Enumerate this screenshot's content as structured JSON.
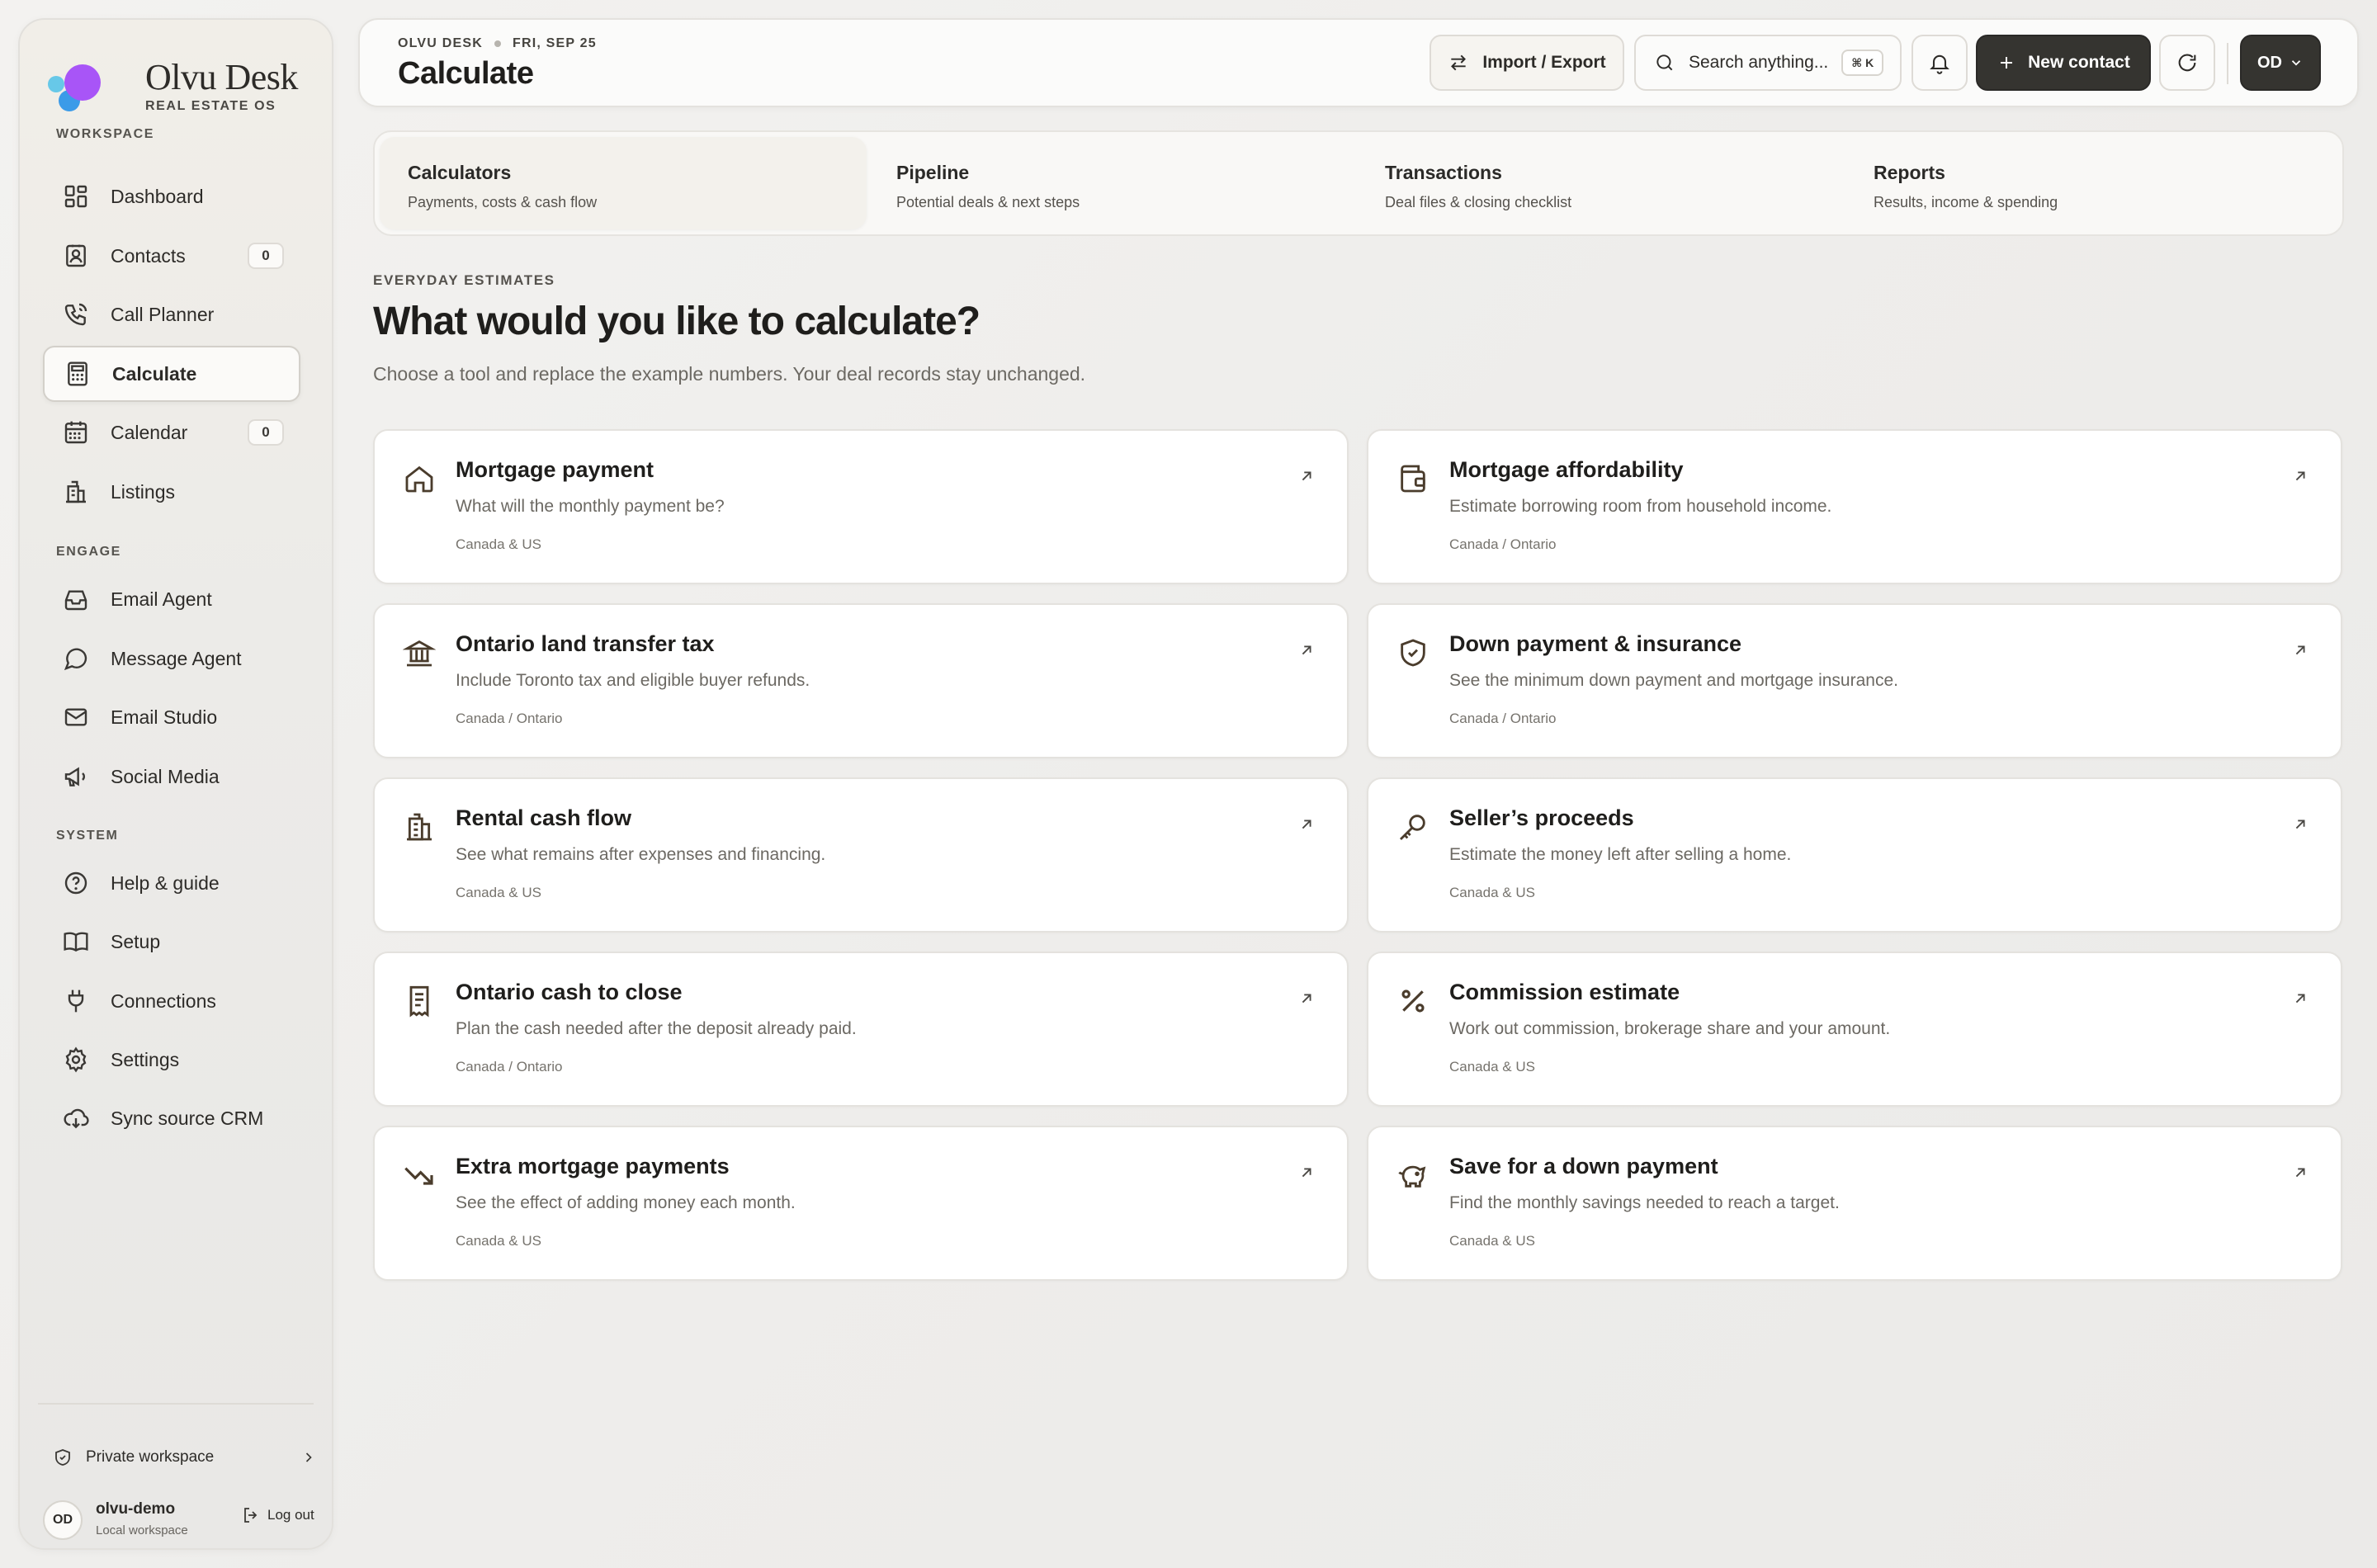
{
  "brand": {
    "name": "Olvu Desk",
    "subtitle": "REAL ESTATE OS",
    "colors": {
      "dot_purple": "#a855f7",
      "dot_blue": "#3b9be8",
      "dot_cyan": "#67c8e8"
    }
  },
  "sidebar": {
    "sections": [
      {
        "label": "WORKSPACE"
      },
      {
        "label": "ENGAGE"
      },
      {
        "label": "SYSTEM"
      }
    ],
    "items": [
      {
        "label": "Dashboard",
        "icon": "dashboard-icon"
      },
      {
        "label": "Contacts",
        "icon": "contacts-icon",
        "count": "0"
      },
      {
        "label": "Call Planner",
        "icon": "phone-icon"
      },
      {
        "label": "Calculate",
        "icon": "calculator-icon",
        "active": true
      },
      {
        "label": "Calendar",
        "icon": "calendar-icon",
        "count": "0"
      },
      {
        "label": "Listings",
        "icon": "building-icon"
      },
      {
        "label": "Email Agent",
        "icon": "inbox-icon"
      },
      {
        "label": "Message Agent",
        "icon": "message-icon"
      },
      {
        "label": "Email Studio",
        "icon": "mail-icon"
      },
      {
        "label": "Social Media",
        "icon": "megaphone-icon"
      },
      {
        "label": "Help & guide",
        "icon": "help-icon"
      },
      {
        "label": "Setup",
        "icon": "book-icon"
      },
      {
        "label": "Connections",
        "icon": "plug-icon"
      },
      {
        "label": "Settings",
        "icon": "gear-icon"
      },
      {
        "label": "Sync source CRM",
        "icon": "cloud-sync-icon"
      }
    ],
    "workspace_label": "Private workspace",
    "user": {
      "initials": "OD",
      "name": "olvu-demo",
      "sub": "Local workspace",
      "logout": "Log out"
    }
  },
  "topbar": {
    "crumb_app": "OLVU DESK",
    "crumb_date": "FRI, SEP 25",
    "title": "Calculate",
    "import_export": "Import / Export",
    "search_placeholder": "Search anything...",
    "search_shortcut": "⌘ K",
    "new_contact": "New contact",
    "account_initials": "OD"
  },
  "tabs": [
    {
      "title": "Calculators",
      "sub": "Payments, costs & cash flow",
      "active": true
    },
    {
      "title": "Pipeline",
      "sub": "Potential deals & next steps"
    },
    {
      "title": "Transactions",
      "sub": "Deal files & closing checklist"
    },
    {
      "title": "Reports",
      "sub": "Results, income & spending"
    }
  ],
  "hero": {
    "eyebrow": "EVERYDAY ESTIMATES",
    "headline": "What would you like to calculate?",
    "subline": "Choose a tool and replace the example numbers. Your deal records stay unchanged."
  },
  "cards": [
    {
      "title": "Mortgage payment",
      "desc": "What will the monthly payment be?",
      "region": "Canada & US",
      "icon": "home-icon"
    },
    {
      "title": "Mortgage affordability",
      "desc": "Estimate borrowing room from household income.",
      "region": "Canada / Ontario",
      "icon": "wallet-icon"
    },
    {
      "title": "Ontario land transfer tax",
      "desc": "Include Toronto tax and eligible buyer refunds.",
      "region": "Canada / Ontario",
      "icon": "landmark-icon"
    },
    {
      "title": "Down payment & insurance",
      "desc": "See the minimum down payment and mortgage insurance.",
      "region": "Canada / Ontario",
      "icon": "shield-check-icon"
    },
    {
      "title": "Rental cash flow",
      "desc": "See what remains after expenses and financing.",
      "region": "Canada & US",
      "icon": "apartment-icon"
    },
    {
      "title": "Seller’s proceeds",
      "desc": "Estimate the money left after selling a home.",
      "region": "Canada & US",
      "icon": "key-icon"
    },
    {
      "title": "Ontario cash to close",
      "desc": "Plan the cash needed after the deposit already paid.",
      "region": "Canada / Ontario",
      "icon": "receipt-icon"
    },
    {
      "title": "Commission estimate",
      "desc": "Work out commission, brokerage share and your amount.",
      "region": "Canada & US",
      "icon": "percent-icon"
    },
    {
      "title": "Extra mortgage payments",
      "desc": "See the effect of adding money each month.",
      "region": "Canada & US",
      "icon": "trending-down-icon"
    },
    {
      "title": "Save for a down payment",
      "desc": "Find the monthly savings needed to reach a target.",
      "region": "Canada & US",
      "icon": "piggy-bank-icon"
    }
  ]
}
